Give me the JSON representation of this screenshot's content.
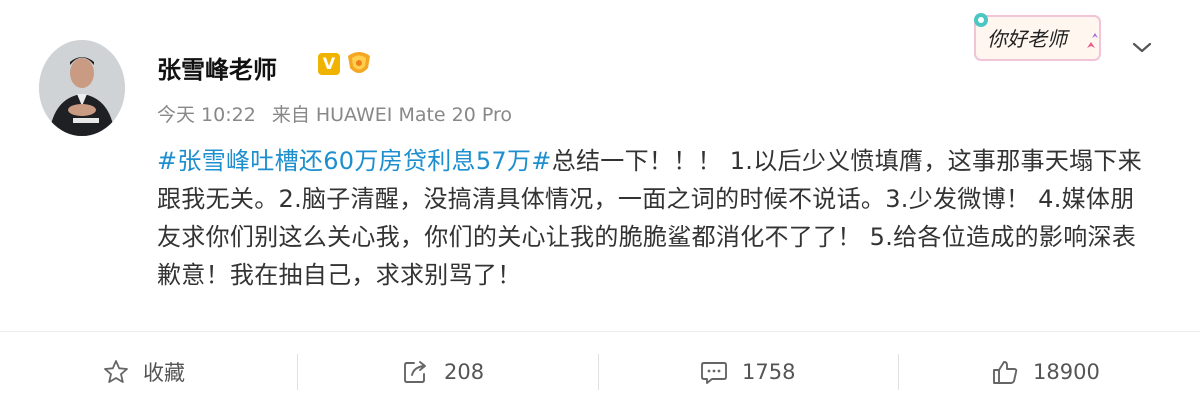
{
  "post": {
    "username": "张雪峰老师",
    "verified_badge": "V",
    "medal_icon": "medal-icon",
    "time": "今天 10:22",
    "source_prefix": "来自",
    "device": "HUAWEI Mate 20 Pro",
    "hashtag": "#张雪峰吐槽还60万房贷利息57万#",
    "body": "总结一下！！！ 1.以后少义愤填膺，这事那事天塌下来跟我无关。2.脑子清醒，没搞清具体情况，一面之词的时候不说话。3.少发微博！ 4.媒体朋友求你们别这么关心我，你们的关心让我的脆脆鲨都消化不了了！ 5.给各位造成的影响深表歉意！我在抽自己，求求别骂了！",
    "sticker_text": "你好老师"
  },
  "actions": {
    "favorite_label": "收藏",
    "repost_count": "208",
    "comment_count": "1758",
    "like_count": "18900"
  },
  "colors": {
    "hashtag": "#1d8fcf",
    "badge": "#f0b400",
    "background": "#f2f2f2"
  }
}
